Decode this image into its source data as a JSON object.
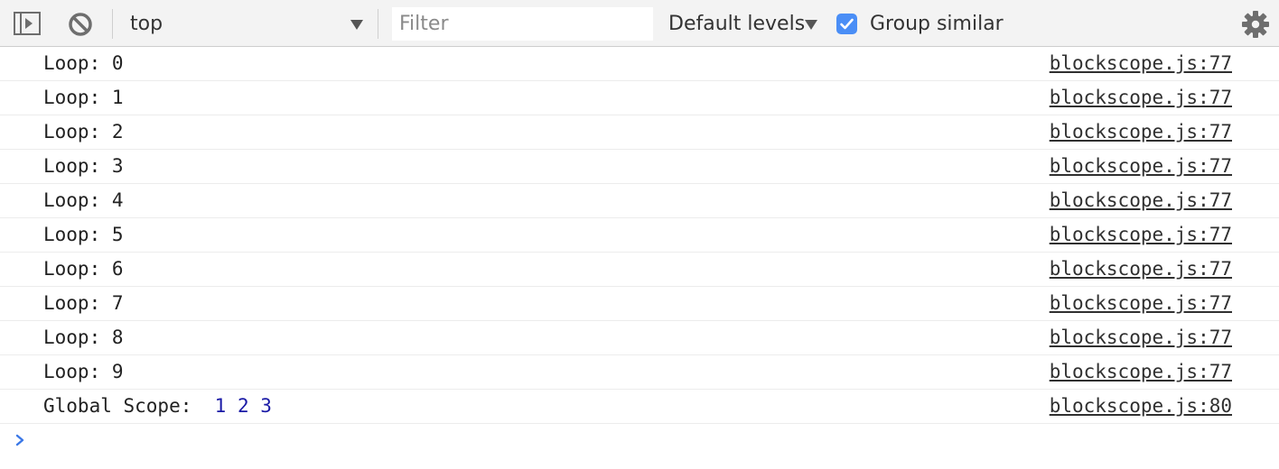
{
  "toolbar": {
    "context_label": "top",
    "filter_placeholder": "Filter",
    "levels_label": "Default levels",
    "group_similar_label": "Group similar",
    "group_similar_checked": true,
    "icons": {
      "sidebar": "sidebar-toggle-icon",
      "clear": "clear-console-icon",
      "context_dropdown": "chevron-down-icon",
      "levels_dropdown": "chevron-down-icon",
      "checkbox": "checkmark-icon",
      "settings": "gear-icon"
    },
    "accent_color": "#4a8ef6"
  },
  "logs": [
    {
      "message": "Loop: 0",
      "source": "blockscope.js:77"
    },
    {
      "message": "Loop: 1",
      "source": "blockscope.js:77"
    },
    {
      "message": "Loop: 2",
      "source": "blockscope.js:77"
    },
    {
      "message": "Loop: 3",
      "source": "blockscope.js:77"
    },
    {
      "message": "Loop: 4",
      "source": "blockscope.js:77"
    },
    {
      "message": "Loop: 5",
      "source": "blockscope.js:77"
    },
    {
      "message": "Loop: 6",
      "source": "blockscope.js:77"
    },
    {
      "message": "Loop: 7",
      "source": "blockscope.js:77"
    },
    {
      "message": "Loop: 8",
      "source": "blockscope.js:77"
    },
    {
      "message": "Loop: 9",
      "source": "blockscope.js:77"
    },
    {
      "message": "Global Scope:",
      "values": "1 2 3",
      "source": "blockscope.js:80"
    }
  ],
  "prompt": {
    "icon": "prompt-caret-icon",
    "color": "#3b78e7"
  }
}
